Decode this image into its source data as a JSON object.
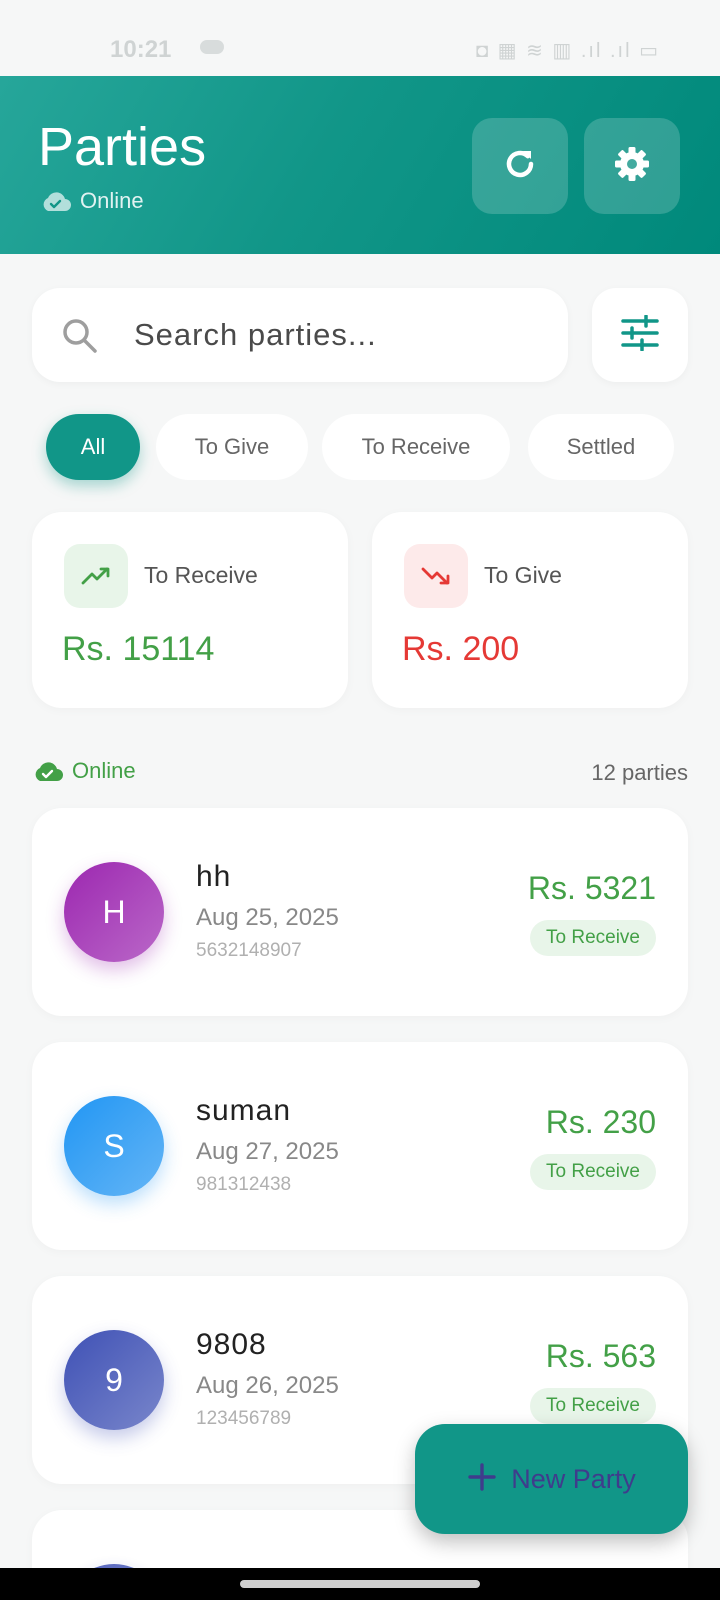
{
  "status_bar": {
    "time": "10:21",
    "icons_text": "◘ ▦ ≋ ▥ .ıl .ıl ▭"
  },
  "header": {
    "title": "Parties",
    "status": "Online"
  },
  "search": {
    "placeholder": "Search parties..."
  },
  "filters": [
    {
      "label": "All",
      "active": true
    },
    {
      "label": "To Give",
      "active": false
    },
    {
      "label": "To Receive",
      "active": false
    },
    {
      "label": "Settled",
      "active": false
    }
  ],
  "summary": {
    "receive": {
      "label": "To Receive",
      "amount": "Rs.  15114",
      "color": "#43a047"
    },
    "give": {
      "label": "To Give",
      "amount": "Rs.  200",
      "color": "#e53935"
    }
  },
  "list": {
    "status": "Online",
    "count": "12 parties",
    "parties": [
      {
        "initial": "H",
        "name": "hh",
        "date": "Aug 25,  2025",
        "phone": "5632148907",
        "amount": "Rs.  5321",
        "badge": "To Receive"
      },
      {
        "initial": "S",
        "name": "suman",
        "date": "Aug 27,  2025",
        "phone": "981312438",
        "amount": "Rs.  230",
        "badge": "To Receive"
      },
      {
        "initial": "9",
        "name": "9808",
        "date": "Aug 26,  2025",
        "phone": "123456789",
        "amount": "Rs.  563",
        "badge": "To Receive"
      }
    ]
  },
  "fab": {
    "label": "New Party",
    "icon": "plus-icon"
  },
  "colors": {
    "primary": "#119688",
    "receive": "#43a047",
    "give": "#e53935"
  }
}
